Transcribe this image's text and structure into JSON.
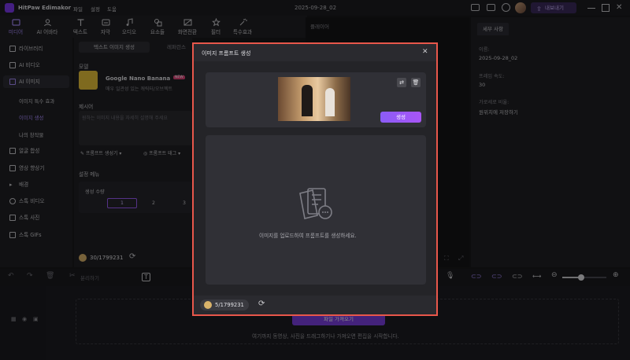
{
  "app": {
    "title": "HitPaw Edimakor",
    "menus": [
      "파일",
      "설정",
      "도움"
    ],
    "project_name": "2025-09-28_02",
    "export_label": "내보내기"
  },
  "toolbar": {
    "tools": [
      {
        "label": "미디어",
        "icon": "media-icon",
        "active": true
      },
      {
        "label": "AI 어바타",
        "icon": "ai-avatar-icon"
      },
      {
        "label": "텍스트",
        "icon": "text-icon"
      },
      {
        "label": "자막",
        "icon": "subtitle-icon"
      },
      {
        "label": "오디오",
        "icon": "audio-icon"
      },
      {
        "label": "요소들",
        "icon": "elements-icon"
      },
      {
        "label": "화면전환",
        "icon": "transition-icon"
      },
      {
        "label": "필터",
        "icon": "filter-icon"
      },
      {
        "label": "특수효과",
        "icon": "effects-icon"
      }
    ]
  },
  "sidebar": {
    "items": [
      {
        "label": "라이브러리"
      },
      {
        "label": "AI 비디오"
      },
      {
        "label": "AI 이미지",
        "selected": true
      }
    ],
    "subitems": [
      "이미지 특수 효과",
      "이미지 생성",
      "나의 창작물"
    ],
    "items2": [
      "얼굴 합성",
      "영상 향상기",
      "배경",
      "스톡 비디오",
      "스톡 사진",
      "스톡 GIFs"
    ]
  },
  "mid": {
    "tab_active": "텍스트 이미지 생성",
    "tab_other": "레퍼런스",
    "model_heading": "모델",
    "model_name": "Google Nano Banana",
    "model_badge": "NEW",
    "model_desc": "매우 일관성 있는 캐릭터/오브젝트",
    "prompt_heading": "제시어",
    "prompt_placeholder": "원하는 이미지 내용을 자세히 설명해 주세요",
    "prompt_gen_btn": "프롬프트 생성기",
    "prompt_tag_btn": "프롬프트 태그",
    "settings_heading": "설정 메뉴",
    "count_label": "생성 수량",
    "counts": [
      "1",
      "2",
      "3"
    ],
    "credits": "30/1799231"
  },
  "preview": {
    "label": "플레이어"
  },
  "right": {
    "tab": "세부 사항",
    "name_label": "이름:",
    "name_value": "2025-09-28_02",
    "fps_label": "프레임 속도:",
    "fps_value": "30",
    "aspect_label": "가로세로 비율:",
    "aspect_value": "원위치에 저장하기"
  },
  "timeline": {
    "split_label": "분리하기",
    "import_button": "파일 가져오기",
    "drop_hint": "여기까지 동영상, 사진을 드래그하기나 가져오면 편집을 시작합니다."
  },
  "dialog": {
    "title": "이미지 프롬프트 생성",
    "generate_button": "생성",
    "empty_text": "이미지를 업로드하여 프롬프트를 생성하세요.",
    "credits": "5/1799231"
  },
  "colors": {
    "accent": "#9b5cf6",
    "highlight": "#e8574b",
    "bg": "#18181b"
  }
}
